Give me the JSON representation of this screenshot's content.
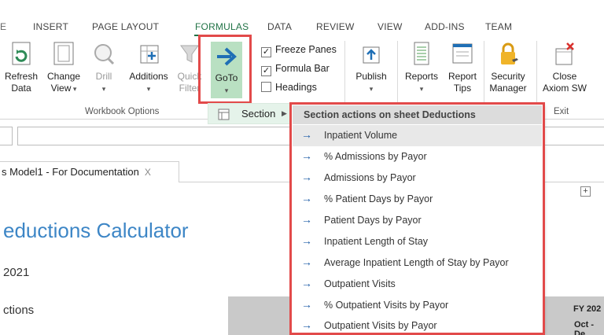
{
  "ribbon": {
    "tabs": [
      "INSERT",
      "PAGE LAYOUT",
      "FORMULAS",
      "DATA",
      "REVIEW",
      "VIEW",
      "ADD-INS",
      "TEAM"
    ],
    "active_tab": "FORMULAS",
    "accent": "#217346",
    "buttons": {
      "refresh": [
        "Refresh",
        "Data"
      ],
      "change": [
        "Change",
        "View"
      ],
      "drill": [
        "Drill"
      ],
      "additions": [
        "Additions"
      ],
      "quick_filter": [
        "Quick",
        "Filter"
      ],
      "goto": [
        "GoTo"
      ],
      "publish": [
        "Publish"
      ],
      "reports": [
        "Reports"
      ],
      "report_tips": [
        "Report",
        "Tips"
      ],
      "security": [
        "Security",
        "Manager"
      ],
      "close_axiom": [
        "Close",
        "Axiom SW"
      ]
    },
    "checkboxes": [
      {
        "label": "Freeze Panes",
        "checked": true
      },
      {
        "label": "Formula Bar",
        "checked": true
      },
      {
        "label": "Headings",
        "checked": false
      }
    ],
    "group_workbook_options": "Workbook Options",
    "group_exit": "Exit",
    "section_label": "Section"
  },
  "document": {
    "tab_name": "s Model1 - For Documentation",
    "tab_close": "X",
    "plus": "+"
  },
  "sheet": {
    "title": "eductions Calculator",
    "year": "2021",
    "section": "ctions",
    "fy": "FY 202",
    "period": "Oct - De"
  },
  "section_menu": {
    "header": "Section actions on sheet Deductions",
    "items": [
      "Inpatient Volume",
      "% Admissions by Payor",
      "Admissions by Payor",
      "% Patient Days by Payor",
      "Patient Days by Payor",
      "Inpatient Length of Stay",
      "Average Inpatient Length of Stay by Payor",
      "Outpatient Visits",
      "% Outpatient Visits by Payor",
      "Outpatient Visits by Payor"
    ],
    "highlight_color": "#e24a4a"
  }
}
